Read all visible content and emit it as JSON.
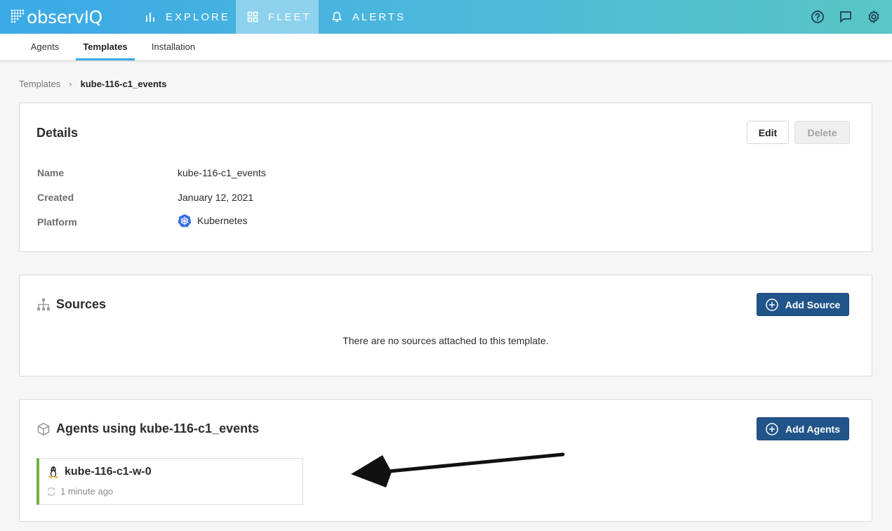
{
  "header": {
    "logo_text_a": "observ",
    "logo_text_b": "IQ",
    "nav": [
      {
        "label": "EXPLORE",
        "icon": "bar-chart-icon"
      },
      {
        "label": "FLEET",
        "icon": "grid-icon"
      },
      {
        "label": "ALERTS",
        "icon": "bell-icon"
      }
    ],
    "right_icons": [
      "help-icon",
      "chat-icon",
      "gear-icon"
    ],
    "accent_colors": [
      "#3aa9e6",
      "#58c6c4"
    ]
  },
  "subnav": {
    "tabs": [
      "Agents",
      "Templates",
      "Installation"
    ],
    "active": "Templates"
  },
  "breadcrumb": {
    "parent": "Templates",
    "separator": "›",
    "current": "kube-116-c1_events"
  },
  "details": {
    "title": "Details",
    "edit_label": "Edit",
    "delete_label": "Delete",
    "fields": {
      "name_label": "Name",
      "name_value": "kube-116-c1_events",
      "created_label": "Created",
      "created_value": "January 12, 2021",
      "platform_label": "Platform",
      "platform_value": "Kubernetes",
      "platform_icon": "kubernetes-icon"
    }
  },
  "sources": {
    "title": "Sources",
    "icon": "sitemap-icon",
    "add_label": "Add Source",
    "empty_message": "There are no sources attached to this template."
  },
  "agents": {
    "title": "Agents using kube-116-c1_events",
    "icon": "cube-icon",
    "add_label": "Add Agents",
    "items": [
      {
        "name": "kube-116-c1-w-0",
        "os_icon": "linux-icon",
        "status_icon": "sync-icon",
        "updated": "1 minute ago",
        "status_color": "#6fb140"
      }
    ]
  },
  "colors": {
    "primary_button": "#21558a",
    "status_ok": "#6fb140"
  }
}
